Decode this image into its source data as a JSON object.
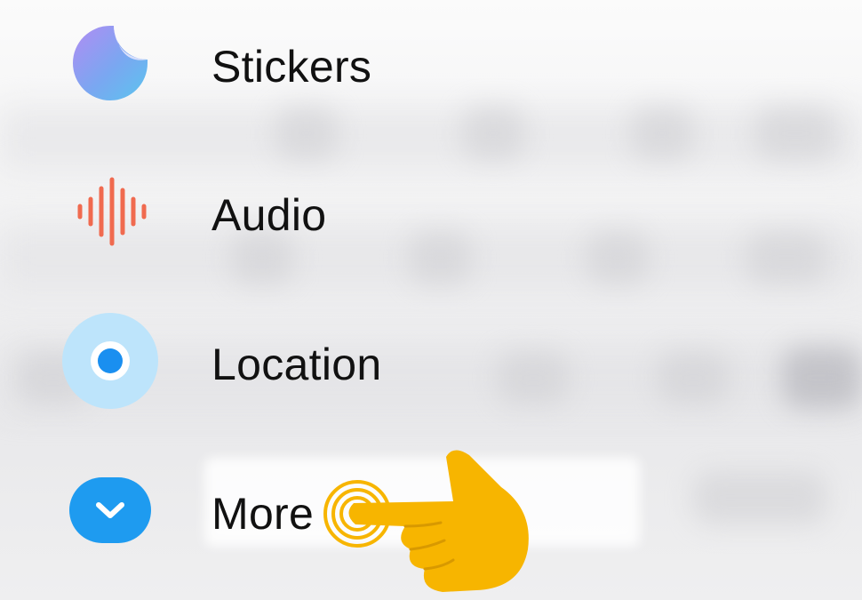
{
  "menu": {
    "items": [
      {
        "id": "stickers",
        "label": "Stickers",
        "icon": "sticker-icon"
      },
      {
        "id": "audio",
        "label": "Audio",
        "icon": "audio-waveform-icon"
      },
      {
        "id": "location",
        "label": "Location",
        "icon": "location-dot-icon"
      },
      {
        "id": "more",
        "label": "More",
        "icon": "chevron-down-icon"
      }
    ]
  },
  "overlay": {
    "pointer": "tap-hand-icon"
  },
  "colors": {
    "audio": "#f06a4f",
    "location_outer": "#bde4fb",
    "location_inner": "#1a8ff0",
    "more": "#1e9bf0",
    "hand": "#f7b500"
  }
}
